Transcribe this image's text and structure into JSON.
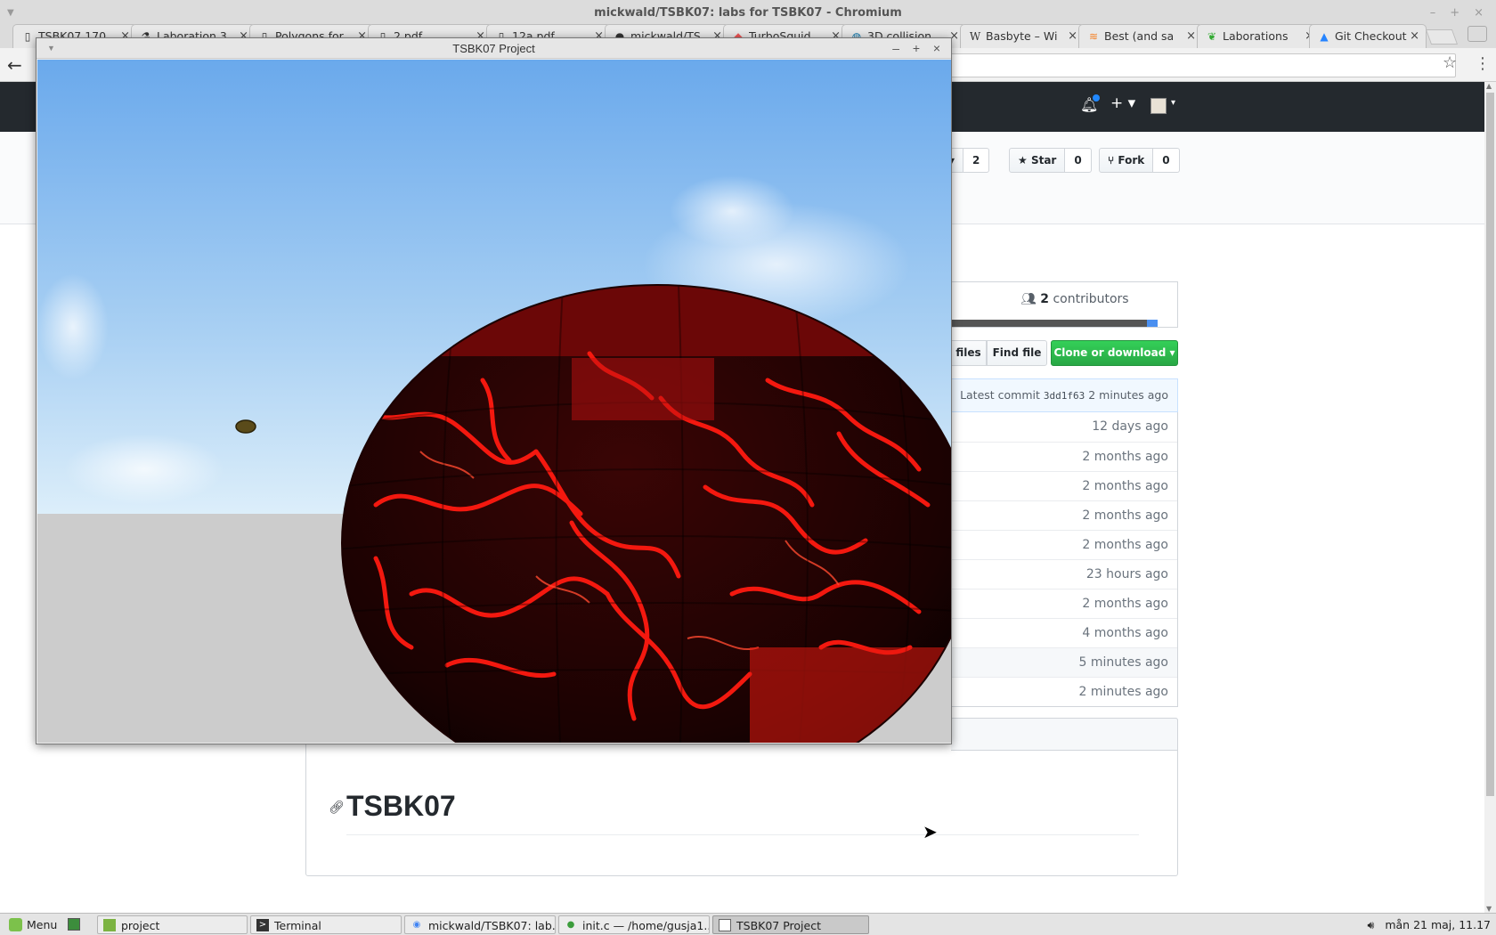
{
  "browser": {
    "window_title": "mickwald/TSBK07: labs for TSBK07 - Chromium",
    "tabs": [
      {
        "label": "TSBK07 170…",
        "icon": "document-icon"
      },
      {
        "label": "Laboration 3",
        "icon": "lab-icon"
      },
      {
        "label": "Polygons for…",
        "icon": "document-icon"
      },
      {
        "label": "2.pdf",
        "icon": "document-icon"
      },
      {
        "label": "12a.pdf",
        "icon": "document-icon"
      },
      {
        "label": "mickwald/TS…",
        "icon": "github-icon"
      },
      {
        "label": "TurboSquid…",
        "icon": "turbosquid-icon"
      },
      {
        "label": "3D collision…",
        "icon": "globe-icon"
      },
      {
        "label": "Basbyte – Wi",
        "icon": "wikipedia-icon"
      },
      {
        "label": "Best (and sa",
        "icon": "stackoverflow-icon"
      },
      {
        "label": "Laborations",
        "icon": "leaf-icon"
      },
      {
        "label": "Git Checkout",
        "icon": "atlassian-icon"
      }
    ]
  },
  "repo": {
    "watch_count": "2",
    "star_label": "Star",
    "star_count": "0",
    "fork_label": "Fork",
    "fork_count": "0",
    "contributors_count": "2",
    "contributors_label": "contributors",
    "files_label": "files",
    "find_file_label": "Find file",
    "clone_label": "Clone or download",
    "latest_commit_label": "Latest commit",
    "latest_commit_sha": "3dd1f63",
    "latest_commit_time": "2 minutes ago",
    "file_ages": [
      "12 days ago",
      "2 months ago",
      "2 months ago",
      "2 months ago",
      "2 months ago",
      "23 hours ago",
      "2 months ago",
      "4 months ago",
      "5 minutes ago",
      "2 minutes ago"
    ],
    "readme_title": "TSBK07"
  },
  "project_window": {
    "title": "TSBK07 Project"
  },
  "taskbar": {
    "menu_label": "Menu",
    "tasks": [
      {
        "label": "project",
        "icon": "folder-icon"
      },
      {
        "label": "Terminal",
        "icon": "terminal-icon"
      },
      {
        "label": "mickwald/TSBK07: lab...",
        "icon": "chromium-icon"
      },
      {
        "label": "init.c — /home/gusja1...",
        "icon": "editor-icon"
      },
      {
        "label": "TSBK07 Project",
        "icon": "window-icon"
      }
    ],
    "clock": "mån 21 maj, 11.17"
  },
  "colors": {
    "github_header": "#24292e",
    "clone_green": "#28a745",
    "sphere_red": "#ff1a10",
    "sky_blue": "#7fb6ee"
  }
}
